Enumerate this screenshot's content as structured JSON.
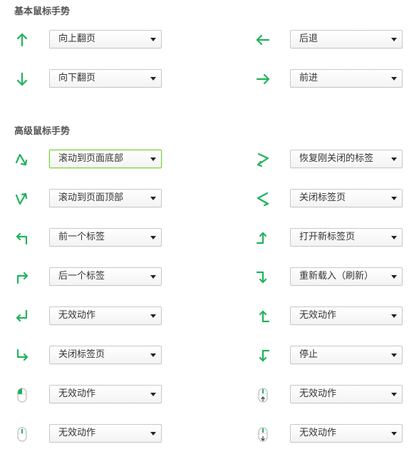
{
  "sections": [
    {
      "title": "基本鼠标手势",
      "rows": [
        {
          "left": {
            "icon": "arrow-up-icon",
            "value": "向上翻页"
          },
          "right": {
            "icon": "arrow-left-icon",
            "value": "后退"
          }
        },
        {
          "left": {
            "icon": "arrow-down-icon",
            "value": "向下翻页"
          },
          "right": {
            "icon": "arrow-right-icon",
            "value": "前进"
          }
        }
      ]
    },
    {
      "title": "高级鼠标手势",
      "rows": [
        {
          "left": {
            "icon": "gesture-up-down-icon",
            "value": "滚动到页面底部",
            "focused": true
          },
          "right": {
            "icon": "gesture-right-left-icon",
            "value": "恢复刚关闭的标签"
          }
        },
        {
          "left": {
            "icon": "gesture-down-up-icon",
            "value": "滚动到页面顶部"
          },
          "right": {
            "icon": "gesture-left-right-icon",
            "value": "关闭标签页"
          }
        },
        {
          "left": {
            "icon": "gesture-up-left-icon",
            "value": "前一个标签"
          },
          "right": {
            "icon": "gesture-right-up-icon",
            "value": "打开新标签页"
          }
        },
        {
          "left": {
            "icon": "gesture-up-right-icon",
            "value": "后一个标签"
          },
          "right": {
            "icon": "gesture-right-down-icon",
            "value": "重新载入（刷新）"
          }
        },
        {
          "left": {
            "icon": "gesture-down-left-icon",
            "value": "无效动作"
          },
          "right": {
            "icon": "gesture-left-up-icon",
            "value": "无效动作"
          }
        },
        {
          "left": {
            "icon": "gesture-down-right-icon",
            "value": "关闭标签页"
          },
          "right": {
            "icon": "gesture-left-down-icon",
            "value": "停止"
          }
        },
        {
          "left": {
            "icon": "mouse-left-button-icon",
            "value": "无效动作"
          },
          "right": {
            "icon": "mouse-wheel-up-icon",
            "value": "无效动作"
          }
        },
        {
          "left": {
            "icon": "mouse-middle-button-icon",
            "value": "无效动作"
          },
          "right": {
            "icon": "mouse-wheel-down-icon",
            "value": "无效动作"
          }
        }
      ]
    }
  ],
  "colors": {
    "accent": "#1fb35b",
    "focus_border": "#7fcf3a"
  }
}
